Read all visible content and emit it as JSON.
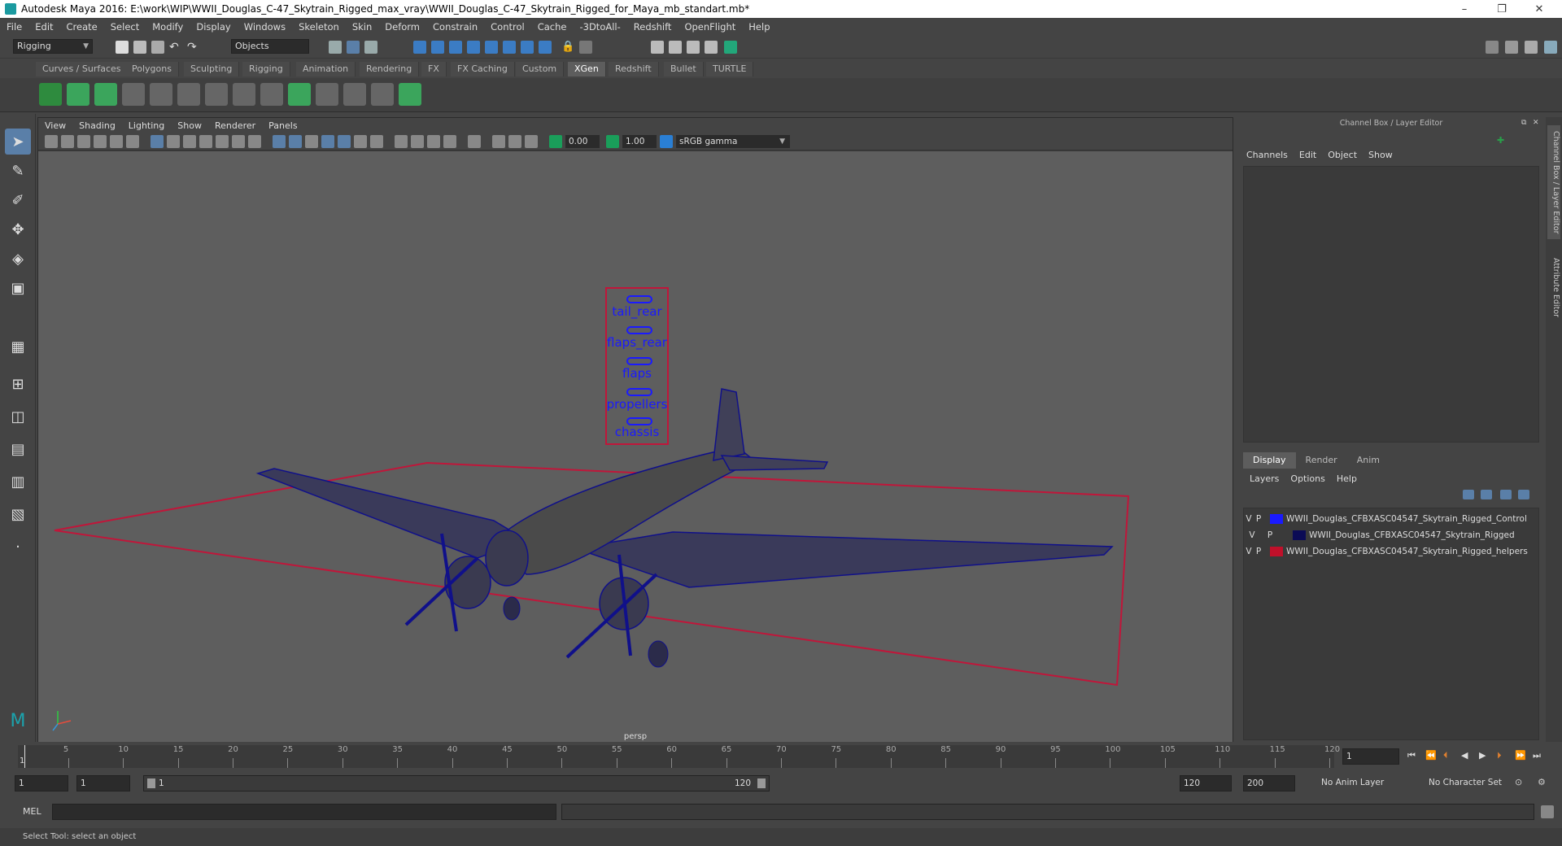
{
  "window": {
    "title": "Autodesk Maya 2016: E:\\work\\WIP\\WWII_Douglas_C-47_Skytrain_Rigged_max_vray\\WWII_Douglas_C-47_Skytrain_Rigged_for_Maya_mb_standart.mb*",
    "minimize": "–",
    "maximize": "❐",
    "close": "✕"
  },
  "menubar": [
    "File",
    "Edit",
    "Create",
    "Select",
    "Modify",
    "Display",
    "Windows",
    "Skeleton",
    "Skin",
    "Deform",
    "Constrain",
    "Control",
    "Cache",
    "-3DtoAll-",
    "Redshift",
    "OpenFlight",
    "Help"
  ],
  "statusline": {
    "mode": "Rigging",
    "selection": "Objects"
  },
  "shelf_tabs": [
    "Curves / Surfaces",
    "Polygons",
    "Sculpting",
    "Rigging",
    "Animation",
    "Rendering",
    "FX",
    "FX Caching",
    "Custom",
    "XGen",
    "Redshift",
    "Bullet",
    "TURTLE"
  ],
  "shelf_active": "XGen",
  "viewport": {
    "menu": [
      "View",
      "Shading",
      "Lighting",
      "Show",
      "Renderer",
      "Panels"
    ],
    "exposure": "0.00",
    "gamma": "1.00",
    "colorspace": "sRGB gamma",
    "camera_label": "persp",
    "controls": [
      "tail_rear",
      "flaps_rear",
      "flaps",
      "propellers",
      "chassis"
    ]
  },
  "channel_box": {
    "title": "Channel Box / Layer Editor",
    "menu": [
      "Channels",
      "Edit",
      "Object",
      "Show"
    ]
  },
  "layer_editor": {
    "tabs": [
      "Display",
      "Render",
      "Anim"
    ],
    "active_tab": "Display",
    "menu": [
      "Layers",
      "Options",
      "Help"
    ],
    "layers": [
      {
        "v": "V",
        "p": "P",
        "name": "WWII_Douglas_CFBXASC04547_Skytrain_Rigged_Control",
        "color": "#1a1aff"
      },
      {
        "v": "V",
        "p": "P",
        "name": "WWII_Douglas_CFBXASC04547_Skytrain_Rigged",
        "color": "#0b0b55"
      },
      {
        "v": "V",
        "p": "P",
        "name": "WWII_Douglas_CFBXASC04547_Skytrain_Rigged_helpers",
        "color": "#c0102a"
      }
    ]
  },
  "side_tabs": [
    "Channel Box / Layer Editor",
    "Attribute Editor"
  ],
  "timeslider": {
    "ticks": [
      "5",
      "10",
      "15",
      "20",
      "25",
      "30",
      "35",
      "40",
      "45",
      "50",
      "55",
      "60",
      "65",
      "70",
      "75",
      "80",
      "85",
      "90",
      "95",
      "100",
      "105",
      "110",
      "115",
      "120"
    ],
    "current": "1",
    "current_field": "1"
  },
  "range": {
    "start": "1",
    "playback_start": "1",
    "slider_start": "1",
    "slider_end": "120",
    "playback_end": "120",
    "end": "200",
    "anim_layer": "No Anim Layer",
    "character_set": "No Character Set"
  },
  "cmdline": {
    "label": "MEL"
  },
  "helpline": "Select Tool: select an object"
}
